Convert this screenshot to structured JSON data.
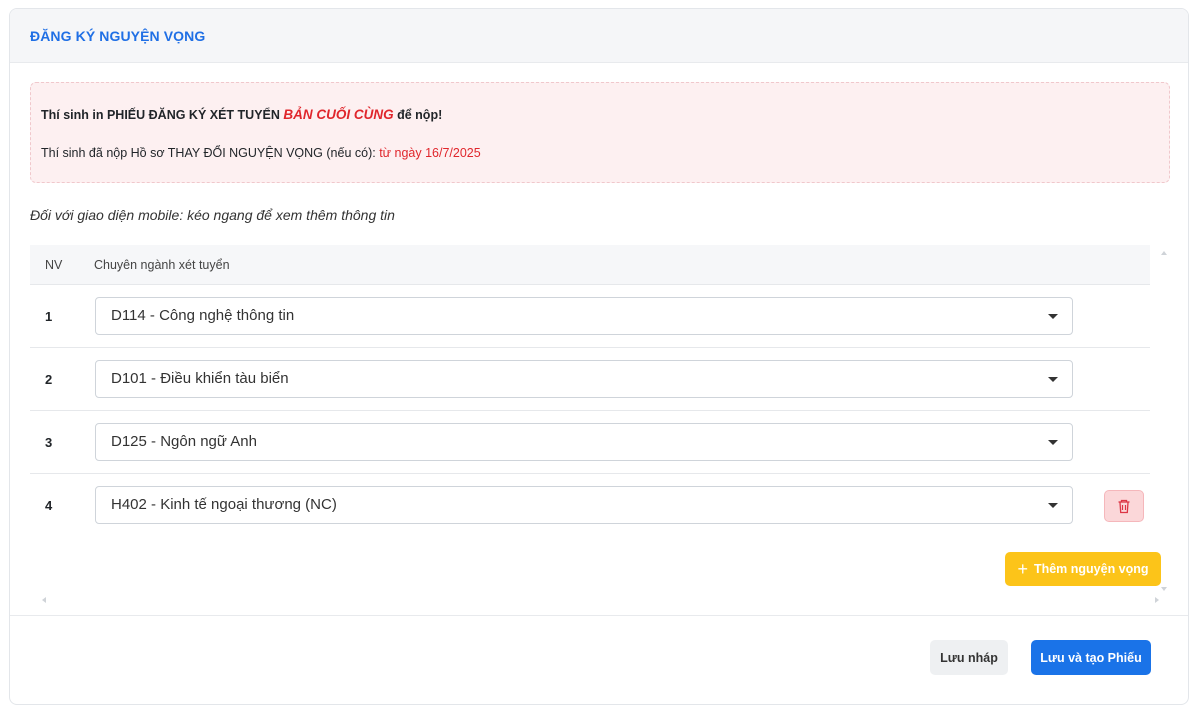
{
  "header": {
    "title": "ĐĂNG KÝ NGUYỆN VỌNG"
  },
  "alert": {
    "line1_prefix": "Thí sinh in PHIẾU ĐĂNG KÝ XÉT TUYỂN ",
    "line1_emphasis": "BẢN CUỐI CÙNG",
    "line1_suffix": " để nộp!",
    "line2_prefix": "Thí sinh đã nộp Hồ sơ THAY ĐỔI NGUYỆN VỌNG (nếu có): ",
    "line2_date": "từ ngày 16/7/2025"
  },
  "mobile_note": "Đối với giao diện mobile: kéo ngang để xem thêm thông tin",
  "table": {
    "headers": {
      "nv": "NV",
      "major": "Chuyên ngành xét tuyển"
    },
    "rows": [
      {
        "num": "1",
        "major": "D114 - Công nghệ thông tin"
      },
      {
        "num": "2",
        "major": "D101 - Điều khiển tàu biển"
      },
      {
        "num": "3",
        "major": "D125 - Ngôn ngữ Anh"
      },
      {
        "num": "4",
        "major": "H402 - Kinh tế ngoại thương (NC)"
      }
    ]
  },
  "buttons": {
    "add_label": "Thêm nguyện vọng",
    "draft_label": "Lưu nháp",
    "save_label": "Lưu và tạo Phiếu"
  },
  "colors": {
    "title_blue": "#1f6fe5",
    "alert_red": "#e0262c",
    "add_yellow": "#fcc419",
    "save_blue": "#1a73e8"
  }
}
